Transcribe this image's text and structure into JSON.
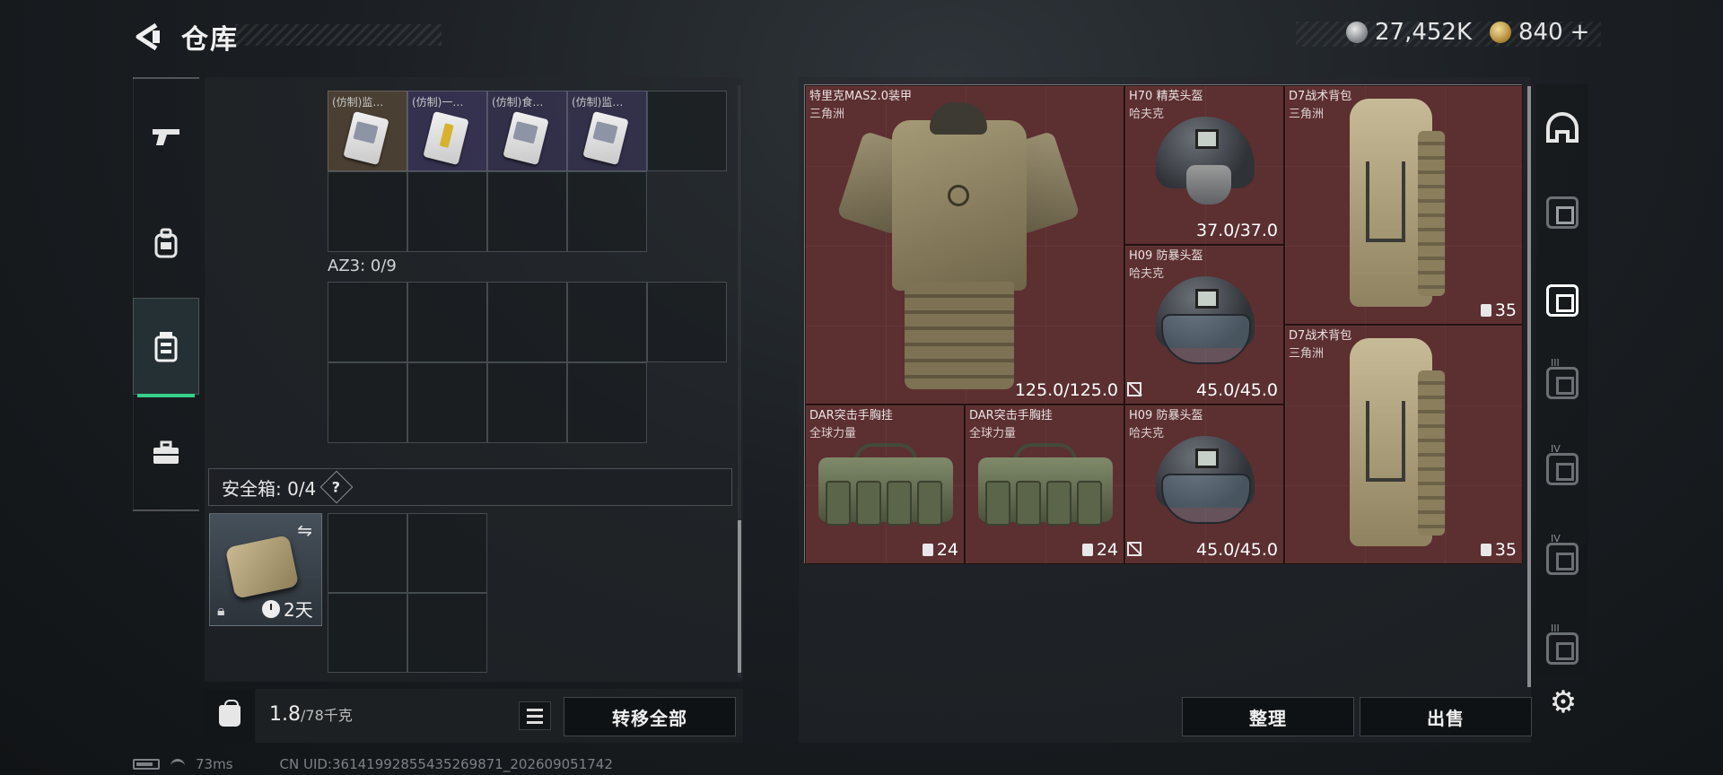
{
  "header": {
    "title": "仓库",
    "currency_silver": "27,452K",
    "currency_gold": "840",
    "gold_add": "+"
  },
  "left_nav": {
    "items": [
      {
        "icon": "pistol-icon"
      },
      {
        "icon": "backpack-icon"
      },
      {
        "icon": "container-icon",
        "active": true
      },
      {
        "icon": "toolbox-icon"
      }
    ]
  },
  "storage": {
    "top_items": [
      {
        "label": "(仿制)监…"
      },
      {
        "label": "(仿制)一…"
      },
      {
        "label": "(仿制)食…"
      },
      {
        "label": "(仿制)监…"
      }
    ],
    "az3_label": "AZ3: 0/9"
  },
  "safe_box": {
    "label": "安全箱: 0/4",
    "help": "?",
    "days": "2天"
  },
  "footer_left": {
    "weight": "1.8",
    "weight_max": "/78千克",
    "transfer_all": "转移全部"
  },
  "gear": [
    {
      "name": "特里克MAS2.0装甲",
      "brand": "三角洲",
      "durability": "125.0/125.0"
    },
    {
      "name": "H70 精英头盔",
      "brand": "哈夫克",
      "durability": "37.0/37.0"
    },
    {
      "name": "D7战术背包",
      "brand": "三角洲",
      "count": "35"
    },
    {
      "name": "H09 防暴头盔",
      "brand": "哈夫克",
      "durability": "45.0/45.0"
    },
    {
      "name": "D7战术背包",
      "brand": "三角洲",
      "count": "35"
    },
    {
      "name": "DAR突击手胸挂",
      "brand": "全球力量",
      "count": "24"
    },
    {
      "name": "DAR突击手胸挂",
      "brand": "全球力量",
      "count": "24"
    },
    {
      "name": "H09 防暴头盔",
      "brand": "哈夫克",
      "durability": "45.0/45.0"
    }
  ],
  "footer_right": {
    "sort": "整理",
    "sell": "出售"
  },
  "tiers": [
    "III",
    "IV",
    "IV",
    "III"
  ],
  "status_bar": {
    "ping": "73ms",
    "uid": "CN UID:3614199285543526987​1_202609051742"
  },
  "colors": {
    "gear_bg": "#5c2f31",
    "accent_green": "#36d08a"
  }
}
